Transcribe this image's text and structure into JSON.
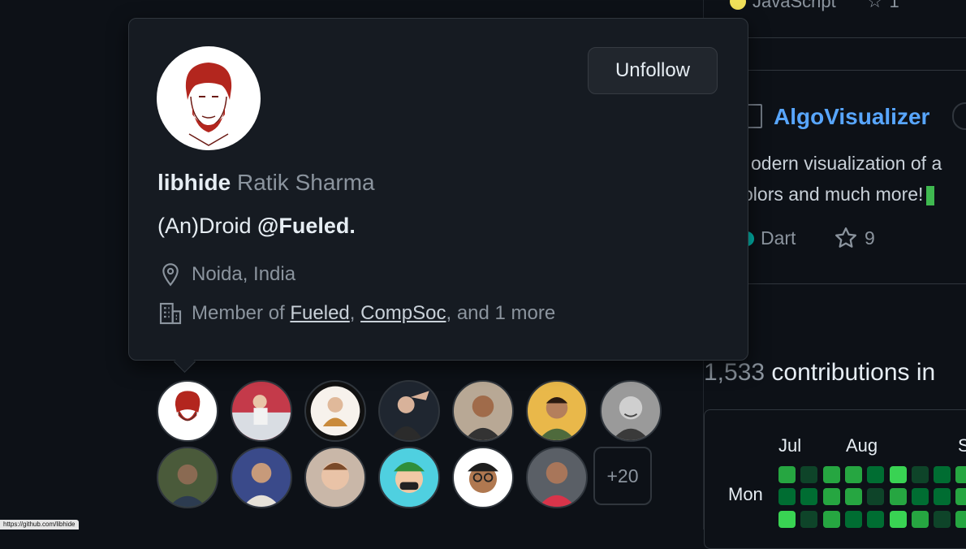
{
  "right_panel": {
    "top_lang": "JavaScript",
    "top_stars": "1",
    "repo": {
      "name": "AlgoVisualizer",
      "description_line1": "odern visualization of a",
      "description_line2": "olors and much more!",
      "language": "Dart",
      "stars": "9"
    },
    "contributions": {
      "count": "1,533",
      "text": "contributions in",
      "months": [
        "Jul",
        "Aug",
        "S"
      ],
      "day_label": "Mon"
    }
  },
  "hovercard": {
    "login": "libhide",
    "name": "Ratik Sharma",
    "bio_prefix": "(An)Droid ",
    "bio_mention": "@Fueled.",
    "location": "Noida, India",
    "member_prefix": "Member of ",
    "orgs": [
      "Fueled",
      "CompSoc"
    ],
    "member_suffix": ", and 1 more",
    "unfollow_label": "Unfollow"
  },
  "followers": {
    "more_label": "+20"
  },
  "statusbar": {
    "url": "https://github.com/libhide"
  },
  "colors": {
    "background": "#0d1117",
    "card": "#161b22",
    "link": "#58a6ff",
    "contrib_green": "#3fb950"
  }
}
